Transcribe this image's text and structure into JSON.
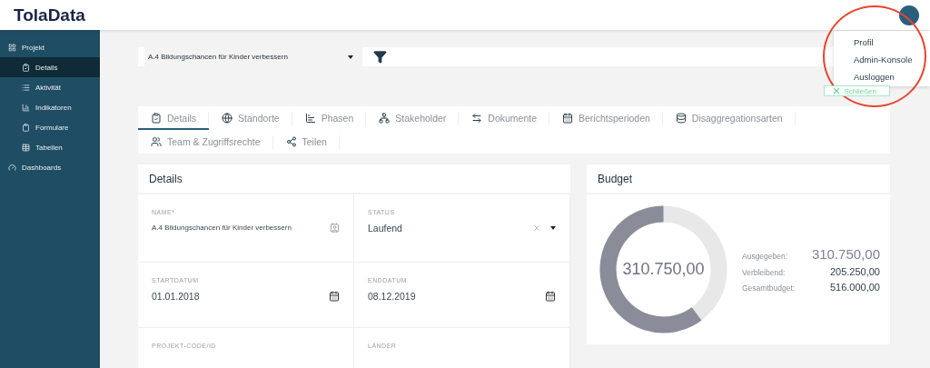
{
  "header": {
    "logo": "TolaData"
  },
  "user_menu": {
    "items": [
      {
        "label": "Profil"
      },
      {
        "label": "Admin-Konsole"
      },
      {
        "label": "Ausloggen"
      }
    ]
  },
  "sidebar": {
    "items": [
      {
        "label": "Projekt",
        "selected": false,
        "children": [
          {
            "label": "Details",
            "selected": true
          },
          {
            "label": "Aktivität",
            "selected": false
          },
          {
            "label": "Indikatoren",
            "selected": false
          },
          {
            "label": "Formulare",
            "selected": false
          },
          {
            "label": "Tabellen",
            "selected": false
          }
        ]
      },
      {
        "label": "Dashboards",
        "selected": false
      }
    ]
  },
  "program_select": {
    "value": "A.4 Bildungschancen für Kinder verbessern"
  },
  "close_button": {
    "label": "Schließen"
  },
  "tabs": [
    {
      "label": "Details",
      "selected": true
    },
    {
      "label": "Standorte",
      "selected": false
    },
    {
      "label": "Phasen",
      "selected": false
    },
    {
      "label": "Stakeholder",
      "selected": false
    },
    {
      "label": "Dokumente",
      "selected": false
    },
    {
      "label": "Berichtsperioden",
      "selected": false
    },
    {
      "label": "Disaggregationsarten",
      "selected": false
    },
    {
      "label": "Team & Zugriffsrechte",
      "selected": false
    },
    {
      "label": "Teilen",
      "selected": false
    }
  ],
  "details": {
    "title": "Details",
    "fields": [
      {
        "kind": "text",
        "label": "NAME*",
        "value": "A.4 Bildungschancen für Kinder verbessern"
      },
      {
        "kind": "select",
        "label": "STATUS",
        "value": "Laufend"
      },
      {
        "kind": "date",
        "label": "STARTDATUM",
        "value": "01.01.2018"
      },
      {
        "kind": "date",
        "label": "ENDDATUM",
        "value": "08.12.2019"
      },
      {
        "kind": "text",
        "label": "PROJEKT-CODE/ID"
      },
      {
        "kind": "text",
        "label": "LÄNDER"
      }
    ]
  },
  "budget": {
    "title": "Budget",
    "center": "310.750,00",
    "rows": [
      {
        "label": "Ausgegeben:",
        "value": "310.750,00",
        "large": true
      },
      {
        "label": "Verbleibend:",
        "value": "205.250,00",
        "large": false
      },
      {
        "label": "Gesamtbudget:",
        "value": "516.000,00",
        "large": false
      }
    ]
  }
}
